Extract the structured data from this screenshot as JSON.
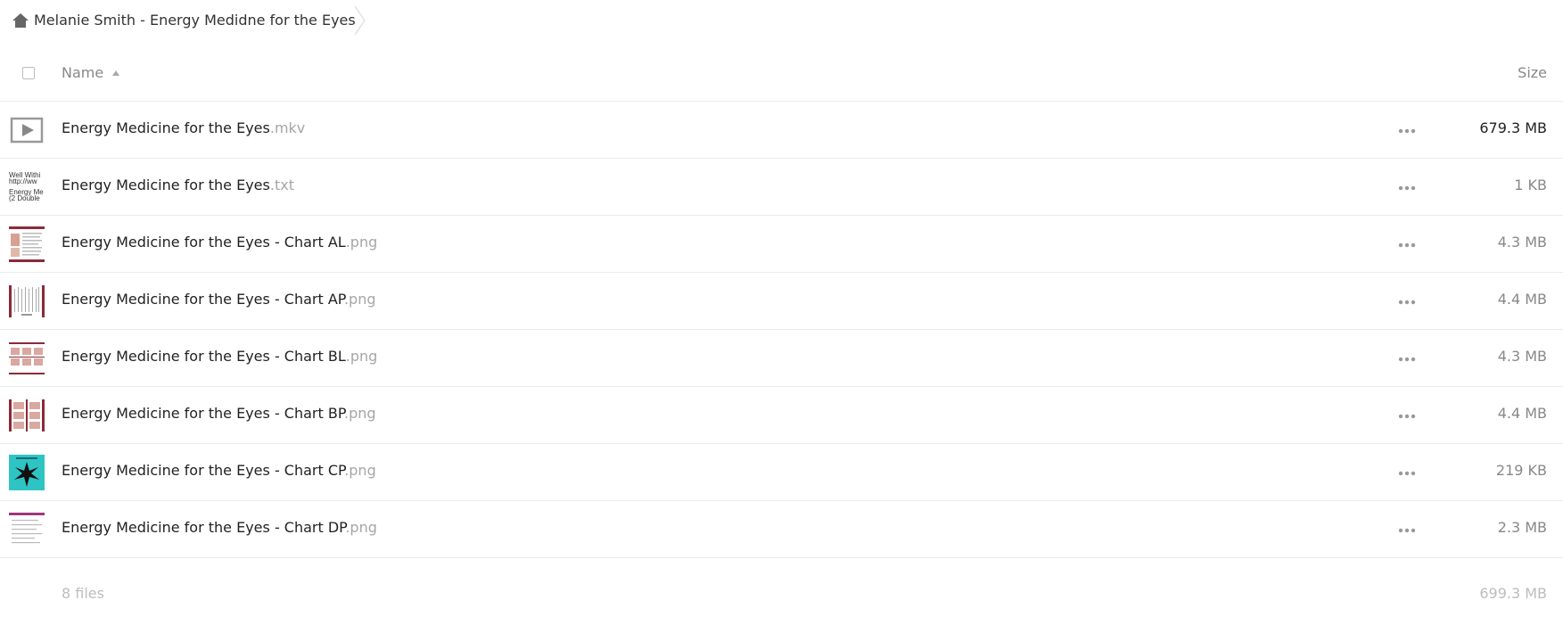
{
  "breadcrumb": {
    "home_icon": "home-icon",
    "current_folder": "Melanie Smith - Energy Medidne for the Eyes"
  },
  "header": {
    "name_label": "Name",
    "size_label": "Size",
    "sort_direction": "ascending"
  },
  "files": [
    {
      "name": "Energy Medicine for the Eyes",
      "ext": ".mkv",
      "size": "679.3 MB",
      "thumb": "video-play-icon",
      "size_emphasis": true
    },
    {
      "name": "Energy Medicine for the Eyes",
      "ext": ".txt",
      "size": "1 KB",
      "thumb": "text-preview",
      "thumb_lines": [
        "Well Withi",
        "http://ww",
        "Energy Me",
        "(2 Double"
      ]
    },
    {
      "name": "Energy Medicine for the Eyes - Chart AL",
      "ext": ".png",
      "size": "4.3 MB",
      "thumb": "chart-preview"
    },
    {
      "name": "Energy Medicine for the Eyes - Chart AP",
      "ext": ".png",
      "size": "4.4 MB",
      "thumb": "chart-preview"
    },
    {
      "name": "Energy Medicine for the Eyes - Chart BL",
      "ext": ".png",
      "size": "4.3 MB",
      "thumb": "chart-preview"
    },
    {
      "name": "Energy Medicine for the Eyes - Chart BP",
      "ext": ".png",
      "size": "4.4 MB",
      "thumb": "chart-preview"
    },
    {
      "name": "Energy Medicine for the Eyes - Chart CP",
      "ext": ".png",
      "size": "219 KB",
      "thumb": "teal-chart-preview"
    },
    {
      "name": "Energy Medicine for the Eyes - Chart DP",
      "ext": ".png",
      "size": "2.3 MB",
      "thumb": "doc-preview"
    }
  ],
  "summary": {
    "count": "8 files",
    "total_size": "699.3 MB"
  },
  "colors": {
    "border": "#ebebeb",
    "muted_text": "#888888",
    "extension_text": "#a6a6a6",
    "chart_accent": "#8b2a3a",
    "teal_accent": "#2ec4c4"
  }
}
